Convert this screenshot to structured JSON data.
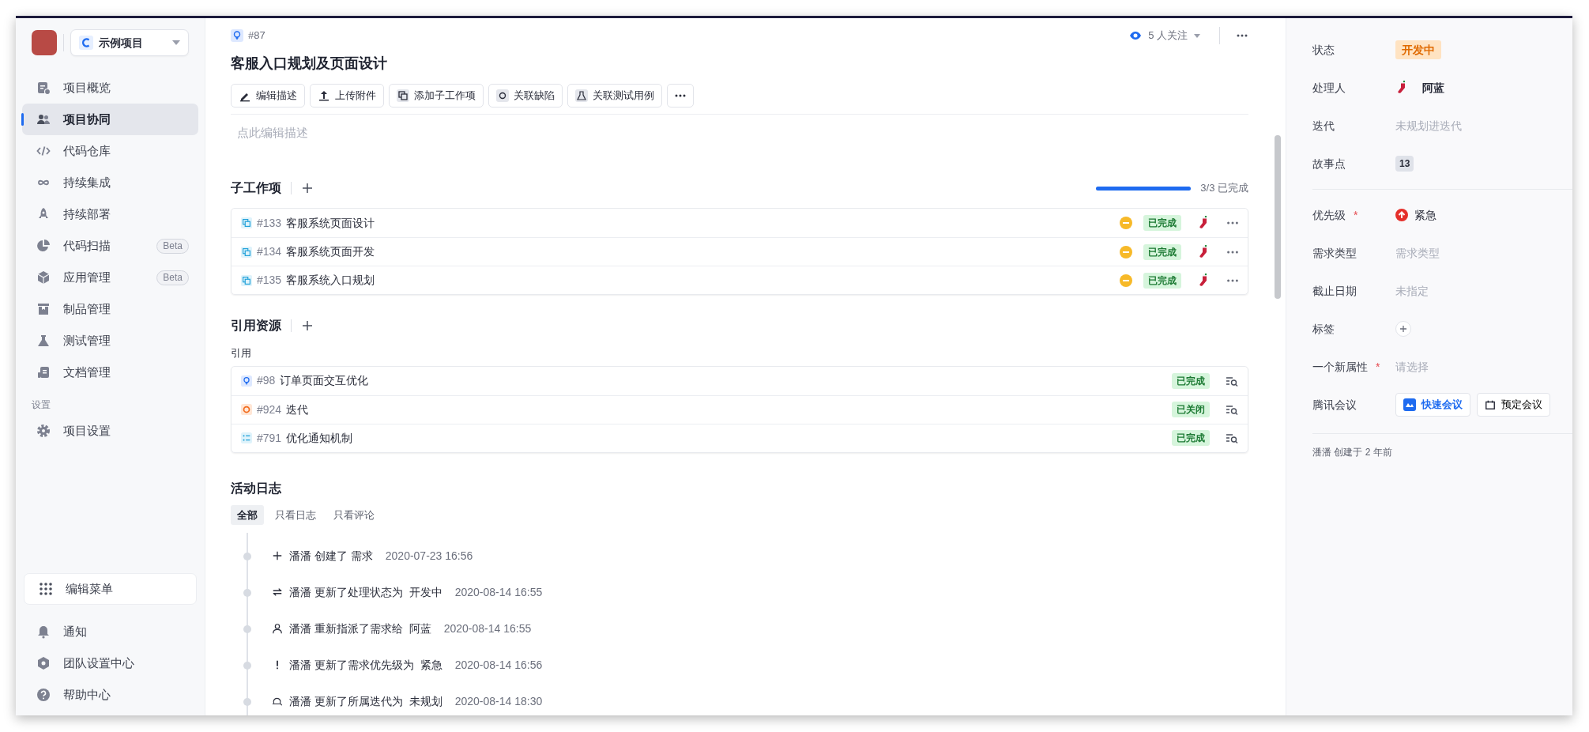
{
  "sidebar": {
    "project": "示例项目",
    "nav": [
      {
        "label": "项目概览",
        "selected": false
      },
      {
        "label": "项目协同",
        "selected": true
      },
      {
        "label": "代码仓库",
        "selected": false
      },
      {
        "label": "持续集成",
        "selected": false
      },
      {
        "label": "持续部署",
        "selected": false
      },
      {
        "label": "代码扫描",
        "selected": false,
        "badge": "Beta"
      },
      {
        "label": "应用管理",
        "selected": false,
        "badge": "Beta"
      },
      {
        "label": "制品管理",
        "selected": false
      },
      {
        "label": "测试管理",
        "selected": false
      },
      {
        "label": "文档管理",
        "selected": false
      }
    ],
    "settings_title": "设置",
    "settings": [
      {
        "label": "项目设置",
        "selected": false
      }
    ],
    "edit_menu": "编辑菜单",
    "footer_nav": [
      {
        "label": "通知"
      },
      {
        "label": "团队设置中心"
      },
      {
        "label": "帮助中心"
      }
    ]
  },
  "issue": {
    "id": "#87",
    "title": "客服入口规划及页面设计",
    "watchers": "5 人关注",
    "toolbar": [
      {
        "label": "编辑描述"
      },
      {
        "label": "上传附件"
      },
      {
        "label": "添加子工作项"
      },
      {
        "label": "关联缺陷"
      },
      {
        "label": "关联测试用例"
      }
    ],
    "description_placeholder": "点此编辑描述"
  },
  "subtasks": {
    "title": "子工作项",
    "progress": {
      "level": 1,
      "text": "3/3 已完成"
    },
    "items": [
      {
        "id": "#133",
        "title": "客服系统页面设计",
        "status": "已完成"
      },
      {
        "id": "#134",
        "title": "客服系统页面开发",
        "status": "已完成"
      },
      {
        "id": "#135",
        "title": "客服系统入口规划",
        "status": "已完成"
      }
    ]
  },
  "references": {
    "title": "引用资源",
    "group": "引用",
    "items": [
      {
        "kind": "requirement",
        "id": "#98",
        "title": "订单页面交互优化",
        "status": "已完成"
      },
      {
        "kind": "iteration",
        "id": "#924",
        "title": "迭代",
        "status": "已关闭"
      },
      {
        "kind": "task",
        "id": "#791",
        "title": "优化通知机制",
        "status": "已完成"
      }
    ]
  },
  "activity": {
    "title": "活动日志",
    "tabs": [
      {
        "label": "全部",
        "selected": true
      },
      {
        "label": "只看日志",
        "selected": false
      },
      {
        "label": "只看评论",
        "selected": false
      }
    ],
    "entries": [
      {
        "kind": "create",
        "text": "潘潘 创建了 需求",
        "time": "2020-07-23 16:56"
      },
      {
        "kind": "status",
        "text": "潘潘 更新了处理状态为  开发中",
        "time": "2020-08-14 16:55"
      },
      {
        "kind": "assign",
        "text": "潘潘 重新指派了需求给  阿蓝",
        "time": "2020-08-14 16:55"
      },
      {
        "kind": "priority",
        "text": "潘潘 更新了需求优先级为  紧急",
        "time": "2020-08-14 16:56"
      },
      {
        "kind": "iteration",
        "text": "潘潘 更新了所属迭代为  未规划",
        "time": "2020-08-14 18:30"
      }
    ]
  },
  "properties": {
    "required_mark": "*",
    "groups": [
      [
        {
          "kind": "status",
          "label": "状态",
          "value": "开发中",
          "required": false
        },
        {
          "kind": "user",
          "label": "处理人",
          "value": "阿蓝",
          "required": false
        },
        {
          "kind": "empty",
          "label": "迭代",
          "value": "未规划进迭代",
          "required": false
        },
        {
          "kind": "count",
          "label": "故事点",
          "value": "13",
          "required": false
        }
      ],
      [
        {
          "kind": "priority",
          "label": "优先级",
          "value": "紧急",
          "required": true
        },
        {
          "kind": "empty",
          "label": "需求类型",
          "value": "需求类型",
          "required": false
        },
        {
          "kind": "empty",
          "label": "截止日期",
          "value": "未指定",
          "required": false
        },
        {
          "kind": "add",
          "label": "标签",
          "required": false
        },
        {
          "kind": "empty",
          "label": "一个新属性",
          "value": "请选择",
          "required": true
        },
        {
          "kind": "meeting",
          "label": "腾讯会议",
          "required": false,
          "buttons": [
            {
              "kind": "quick",
              "label": "快速会议"
            },
            {
              "kind": "schedule",
              "label": "预定会议"
            }
          ]
        }
      ]
    ],
    "footer": "潘潘 创建于 2 年前"
  }
}
